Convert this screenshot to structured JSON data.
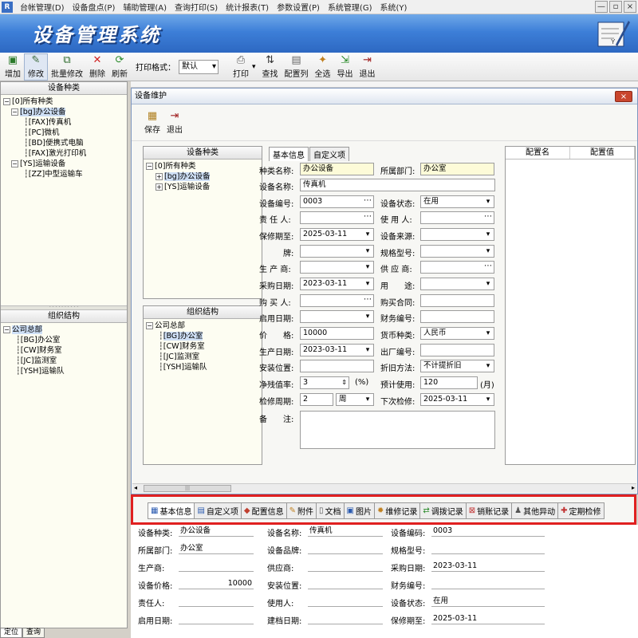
{
  "menu": {
    "items": [
      "台帐管理(D)",
      "设备盘点(P)",
      "辅助管理(A)",
      "查询打印(S)",
      "统计报表(T)",
      "参数设置(P)",
      "系统管理(G)",
      "系统(Y)"
    ]
  },
  "window_controls": {
    "minimize": "—",
    "restore": "▫",
    "close": "×"
  },
  "banner": {
    "title": "设备管理系统"
  },
  "toolbar": {
    "add": "增加",
    "edit": "修改",
    "batch_edit": "批量修改",
    "delete": "删除",
    "refresh": "刷新",
    "print_format_label": "打印格式：",
    "print_format_value": "默认",
    "print": "打印",
    "find": "查找",
    "config_columns": "配置列",
    "select_all": "全选",
    "export": "导出",
    "exit": "退出"
  },
  "left_panel": {
    "category_header": "设备种类",
    "category_tree": [
      {
        "label": "[0]所有种类",
        "level": 0,
        "box": "−"
      },
      {
        "label": "[bg]办公设备",
        "level": 1,
        "box": "−",
        "highlight": true
      },
      {
        "label": "[FAX]传真机",
        "level": 2
      },
      {
        "label": "[PC]微机",
        "level": 2
      },
      {
        "label": "[BD]便携式电脑",
        "level": 2
      },
      {
        "label": "[FAX]激光打印机",
        "level": 2
      },
      {
        "label": "[YS]运输设备",
        "level": 1,
        "box": "−"
      },
      {
        "label": "[ZZ]中型运输车",
        "level": 2
      }
    ],
    "org_header": "组织结构",
    "org_tree": [
      {
        "label": "公司总部",
        "level": 0,
        "box": "−",
        "highlight": true
      },
      {
        "label": "[BG]办公室",
        "level": 1
      },
      {
        "label": "[CW]财务室",
        "level": 1
      },
      {
        "label": "[JC]监测室",
        "level": 1
      },
      {
        "label": "[YSH]运输队",
        "level": 1
      }
    ],
    "bottom_tabs": [
      "定位",
      "查询"
    ]
  },
  "dialog": {
    "title": "设备维护",
    "close": "×",
    "save": "保存",
    "exit": "退出",
    "category_header": "设备种类",
    "category_tree": [
      {
        "label": "[0]所有种类",
        "level": 0,
        "box": "−"
      },
      {
        "label": "[bg]办公设备",
        "level": 1,
        "box": "+",
        "highlight": true
      },
      {
        "label": "[YS]运输设备",
        "level": 1,
        "box": "+"
      }
    ],
    "org_header": "组织结构",
    "org_tree": [
      {
        "label": "公司总部",
        "level": 0,
        "box": "−"
      },
      {
        "label": "[BG]办公室",
        "level": 1,
        "highlight": true
      },
      {
        "label": "[CW]财务室",
        "level": 1
      },
      {
        "label": "[JC]监测室",
        "level": 1
      },
      {
        "label": "[YSH]运输队",
        "level": 1
      }
    ],
    "form_tabs": [
      "基本信息",
      "自定义项"
    ],
    "fields": {
      "category_label": "种类名称:",
      "category_value": "办公设备",
      "dept_label": "所属部门:",
      "dept_value": "办公室",
      "name_label": "设备名称:",
      "name_value": "传真机",
      "code_label": "设备编号:",
      "code_value": "0003",
      "status_label": "设备状态:",
      "status_value": "在用",
      "owner_label": "责 任 人:",
      "owner_value": "",
      "user_label": "使 用 人:",
      "user_value": "",
      "warranty_label": "保修期至:",
      "warranty_value": "2025-03-11",
      "source_label": "设备来源:",
      "source_value": "",
      "brand_label": "牌:",
      "brand_value": "",
      "model_label": "规格型号:",
      "model_value": "",
      "maker_label": "生 产 商:",
      "maker_value": "",
      "supplier_label": "供 应 商:",
      "supplier_value": "",
      "purchase_date_label": "采购日期:",
      "purchase_date_value": "2023-03-11",
      "purpose_label": "用　　途:",
      "purpose_value": "",
      "buyer_label": "购 买 人:",
      "buyer_value": "",
      "contract_label": "购买合同:",
      "contract_value": "",
      "start_date_label": "启用日期:",
      "start_date_value": "",
      "fin_code_label": "财务编号:",
      "fin_code_value": "",
      "price_label": "价　　格:",
      "price_value": "10000",
      "currency_label": "货币种类:",
      "currency_value": "人民币",
      "prod_date_label": "生产日期:",
      "prod_date_value": "2023-03-11",
      "factory_code_label": "出厂编号:",
      "factory_code_value": "",
      "location_label": "安装位置:",
      "location_value": "",
      "depr_label": "折旧方法:",
      "depr_value": "不计提折旧",
      "residual_label": "净残值率:",
      "residual_value": "3",
      "residual_unit": "(%)",
      "expected_label": "预计使用:",
      "expected_value": "120",
      "expected_unit": "(月)",
      "cycle_label": "检修周期:",
      "cycle_value": "2",
      "cycle_unit_value": "周",
      "next_label": "下次检修:",
      "next_value": "2025-03-11",
      "remark_label": "备　　注:",
      "remark_value": ""
    },
    "config_headers": [
      "配置名",
      "配置值"
    ]
  },
  "bottom_tabs": [
    "基本信息",
    "自定义项",
    "配置信息",
    "附件",
    "文档",
    "图片",
    "维修记录",
    "调拨记录",
    "销账记录",
    "其他异动",
    "定期检修"
  ],
  "detail": {
    "category_label": "设备种类:",
    "category_value": "办公设备",
    "name_label": "设备名称:",
    "name_value": "传真机",
    "code_label": "设备编码:",
    "code_value": "0003",
    "dept_label": "所属部门:",
    "dept_value": "办公室",
    "brand_label": "设备品牌:",
    "brand_value": "",
    "model_label": "规格型号:",
    "model_value": "",
    "maker_label": "生产商:",
    "maker_value": "",
    "supplier_label": "供应商:",
    "supplier_value": "",
    "purchase_label": "采购日期:",
    "purchase_value": "2023-03-11",
    "price_label": "设备价格:",
    "price_value": "10000",
    "location_label": "安装位置:",
    "location_value": "",
    "fin_label": "财务编号:",
    "fin_value": "",
    "owner_label": "责任人:",
    "owner_value": "",
    "user_label": "使用人:",
    "user_value": "",
    "status_label": "设备状态:",
    "status_value": "在用",
    "start_label": "启用日期:",
    "start_value": "",
    "archive_label": "建档日期:",
    "archive_value": "",
    "warranty_label": "保修期至:",
    "warranty_value": "2025-03-11"
  },
  "colors": {
    "banner": "#3d7fd8",
    "highlight_box": "#e02020",
    "tree_highlight": "#cfe0f6"
  }
}
